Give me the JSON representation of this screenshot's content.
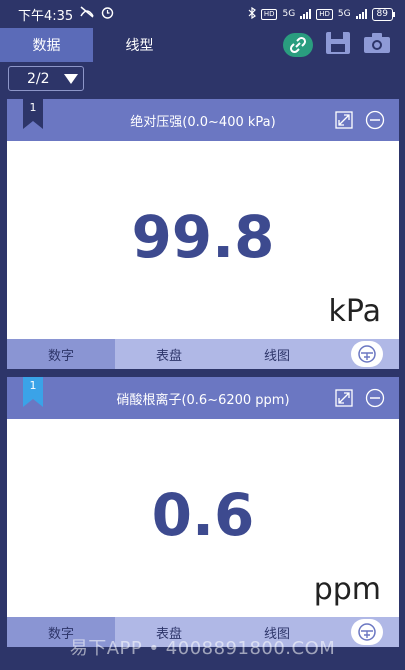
{
  "status": {
    "time": "下午4:35",
    "battery": "89",
    "net1": "5G",
    "net2": "5G",
    "hd": "HD"
  },
  "tabs": {
    "data": "数据",
    "line": "线型"
  },
  "pager": {
    "value": "2/2"
  },
  "cards": [
    {
      "index": "1",
      "title": "绝对压强(0.0~400 kPa)",
      "value": "99.8",
      "unit": "kPa",
      "ribbon_color": "#2d3569",
      "footer": {
        "digital": "数字",
        "dial": "表盘",
        "chart": "线图"
      }
    },
    {
      "index": "1",
      "title": "硝酸根离子(0.6~6200 ppm)",
      "value": "0.6",
      "unit": "ppm",
      "ribbon_color": "#3aa3e8",
      "footer": {
        "digital": "数字",
        "dial": "表盘",
        "chart": "线图"
      }
    }
  ],
  "watermark": "易下APP • 4008891800.COM",
  "colors": {
    "accent": "#6b77c2",
    "link": "#2a9d7f",
    "value": "#3d4a8f"
  }
}
